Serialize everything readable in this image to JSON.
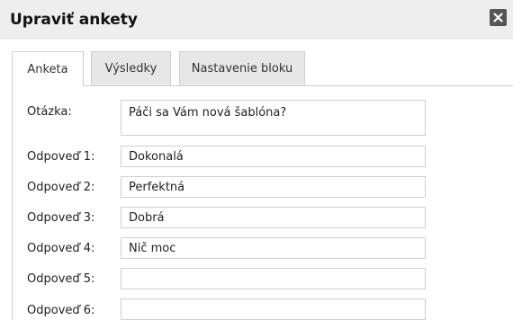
{
  "dialog": {
    "title": "Upraviť ankety",
    "close_icon": "close-icon"
  },
  "tabs": [
    {
      "label": "Anketa",
      "active": true
    },
    {
      "label": "Výsledky",
      "active": false
    },
    {
      "label": "Nastavenie bloku",
      "active": false
    }
  ],
  "form": {
    "question_label": "Otázka:",
    "question_value": "Páči sa Vám nová šablóna?",
    "answers": [
      {
        "label": "Odpoveď 1:",
        "value": "Dokonalá"
      },
      {
        "label": "Odpoveď 2:",
        "value": "Perfektná"
      },
      {
        "label": "Odpoveď 3:",
        "value": "Dobrá"
      },
      {
        "label": "Odpoveď 4:",
        "value": "Nič moc"
      },
      {
        "label": "Odpoveď 5:",
        "value": ""
      },
      {
        "label": "Odpoveď 6:",
        "value": ""
      }
    ]
  }
}
